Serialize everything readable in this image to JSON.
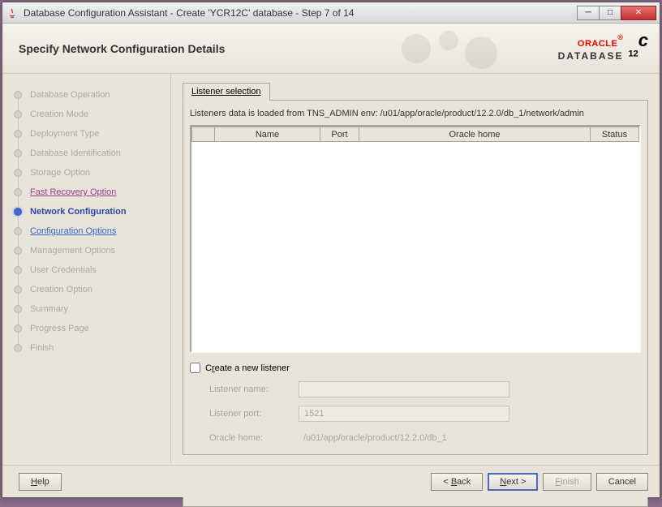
{
  "window": {
    "title": "Database Configuration Assistant - Create 'YCR12C' database - Step 7 of 14"
  },
  "header": {
    "title": "Specify Network Configuration Details",
    "brand_oracle": "ORACLE",
    "brand_db": "DATABASE",
    "brand_version": "12",
    "brand_suffix": "c"
  },
  "steps": [
    {
      "label": "Database Operation",
      "state": "done"
    },
    {
      "label": "Creation Mode",
      "state": "done"
    },
    {
      "label": "Deployment Type",
      "state": "done"
    },
    {
      "label": "Database Identification",
      "state": "done"
    },
    {
      "label": "Storage Option",
      "state": "done"
    },
    {
      "label": "Fast Recovery Option",
      "state": "completed"
    },
    {
      "label": "Network Configuration",
      "state": "current"
    },
    {
      "label": "Configuration Options",
      "state": "next"
    },
    {
      "label": "Management Options",
      "state": "future"
    },
    {
      "label": "User Credentials",
      "state": "future"
    },
    {
      "label": "Creation Option",
      "state": "future"
    },
    {
      "label": "Summary",
      "state": "future"
    },
    {
      "label": "Progress Page",
      "state": "future"
    },
    {
      "label": "Finish",
      "state": "future"
    }
  ],
  "main": {
    "tab_label": "Listener selection",
    "info": "Listeners data is loaded from TNS_ADMIN env: /u01/app/oracle/product/12.2.0/db_1/network/admin",
    "columns": {
      "name": "Name",
      "port": "Port",
      "home": "Oracle home",
      "status": "Status"
    },
    "create_listener": {
      "label_pre": "C",
      "label_u": "r",
      "label_post": "eate a new listener",
      "checked": false
    },
    "form": {
      "name_label": "Listener name:",
      "name_value": "",
      "port_label": "Listener port:",
      "port_value": "1521",
      "home_label": "Oracle home:",
      "home_value": "/u01/app/oracle/product/12.2.0/db_1"
    }
  },
  "footer": {
    "help": "Help",
    "back": "Back",
    "next": "Next",
    "finish": "Finish",
    "cancel": "Cancel"
  }
}
